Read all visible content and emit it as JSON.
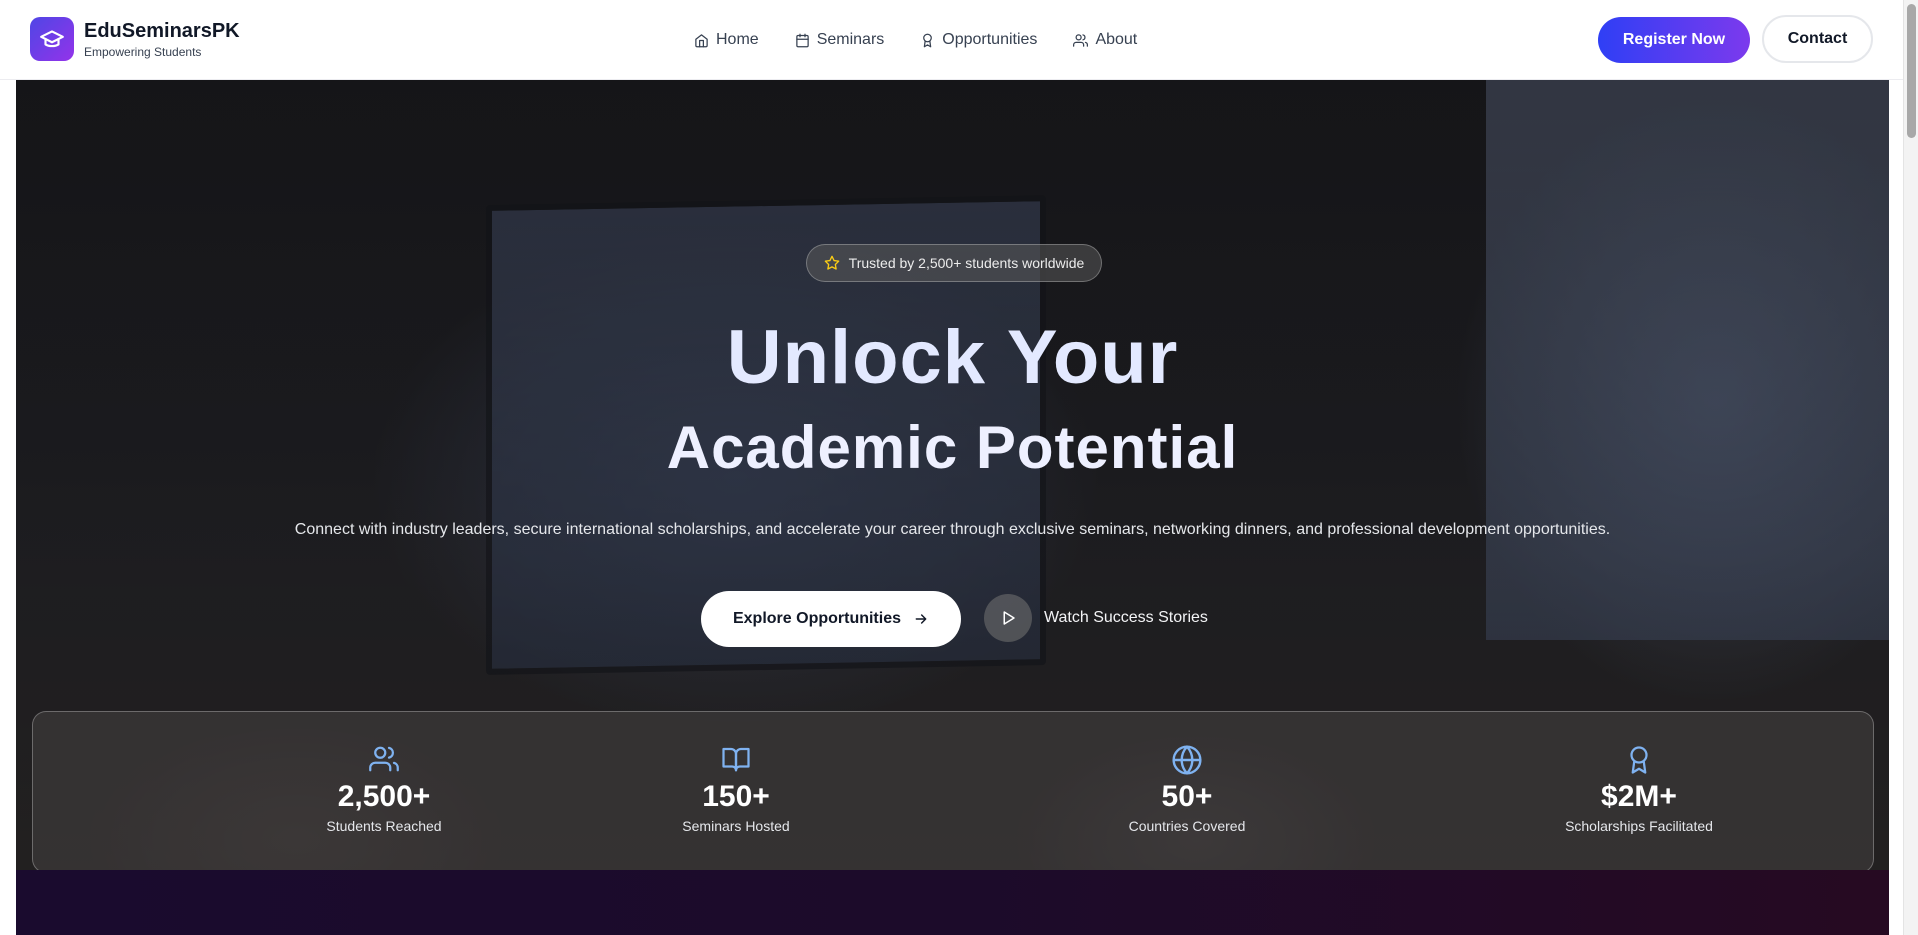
{
  "brand": {
    "name": "EduSeminarsPK",
    "tagline": "Empowering Students",
    "logo_icon": "graduation-cap-icon"
  },
  "nav": {
    "links": [
      {
        "label": "Home",
        "icon": "home-icon"
      },
      {
        "label": "Seminars",
        "icon": "calendar-icon"
      },
      {
        "label": "Opportunities",
        "icon": "award-icon"
      },
      {
        "label": "About",
        "icon": "users-icon"
      }
    ],
    "register_label": "Register Now",
    "contact_label": "Contact"
  },
  "hero": {
    "badge": "Trusted by 2,500+ students worldwide",
    "headline_line1": "Unlock Your",
    "headline_line2": "Academic Potential",
    "subtext": "Connect with industry leaders, secure international scholarships, and accelerate your career through exclusive seminars, networking dinners, and professional development opportunities.",
    "explore_label": "Explore Opportunities",
    "watch_label": "Watch Success Stories"
  },
  "stats": [
    {
      "value": "2,500+",
      "label": "Students Reached",
      "icon": "users-icon"
    },
    {
      "value": "150+",
      "label": "Seminars Hosted",
      "icon": "book-open-icon"
    },
    {
      "value": "50+",
      "label": "Countries Covered",
      "icon": "globe-icon"
    },
    {
      "value": "$2M+",
      "label": "Scholarships Facilitated",
      "icon": "award-icon"
    }
  ],
  "colors": {
    "brand_gradient_start": "#4f46e5",
    "brand_gradient_end": "#9333ea",
    "register_gradient_start": "#2f3ff5",
    "register_gradient_end": "#7c3aed",
    "stat_icon": "#7fb2f0",
    "star_icon": "#facc15"
  }
}
